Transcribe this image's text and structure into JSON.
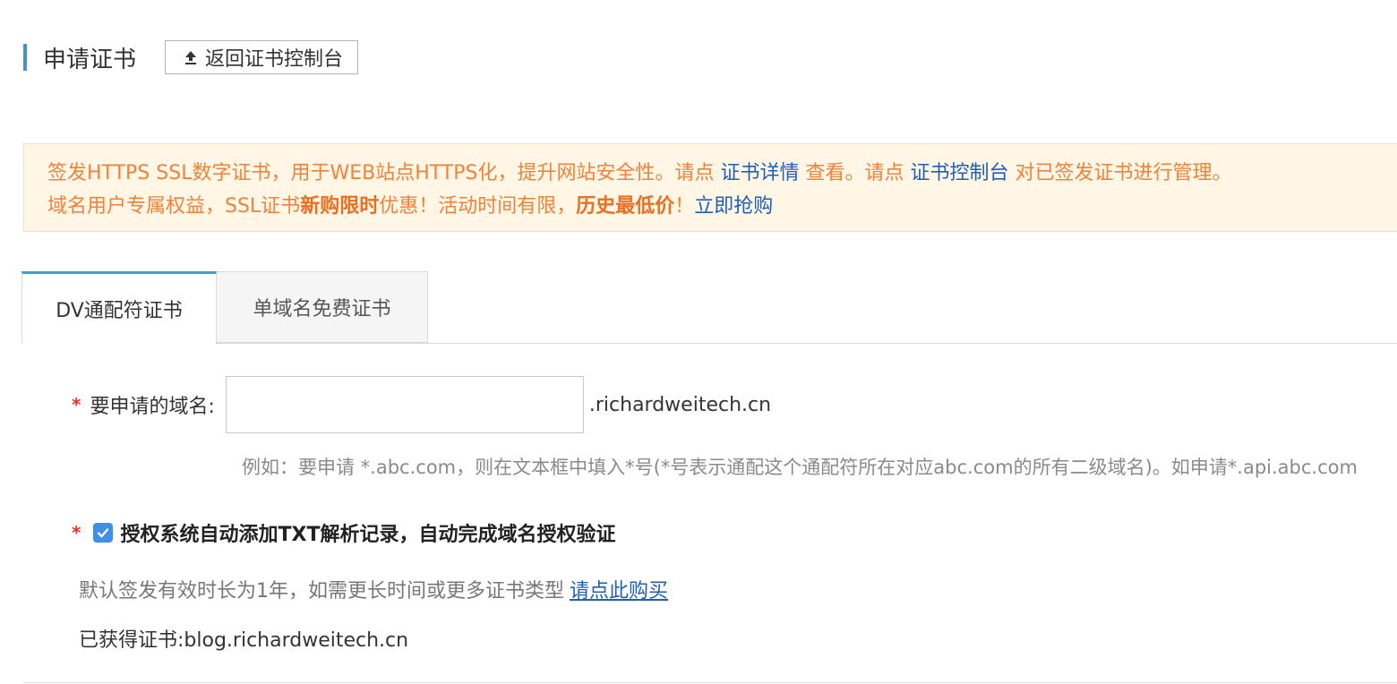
{
  "header": {
    "title": "申请证书",
    "back_button_label": "返回证书控制台",
    "accent_color": "#4a90c8"
  },
  "notice": {
    "line1_prefix": "签发HTTPS SSL数字证书，用于WEB站点HTTPS化，提升网站安全性。请点 ",
    "line1_link1": "证书详情",
    "line1_mid": " 查看。请点 ",
    "line1_link2": "证书控制台",
    "line1_suffix": " 对已签发证书进行管理。",
    "line2_part1": "域名用户专属权益，SSL证书",
    "line2_bold1": "新购限时",
    "line2_part2": "优惠！活动时间有限，",
    "line2_bold2": "历史最低价",
    "line2_part3": "！",
    "line2_link": "立即抢购",
    "text_color": "#f0823a",
    "link_color": "#1f5fb8",
    "background": "#fff6e5"
  },
  "tabs": [
    {
      "label": "DV通配符证书",
      "active": true
    },
    {
      "label": "单域名免费证书",
      "active": false
    }
  ],
  "form": {
    "required_mark": "*",
    "domain_label": "要申请的域名:",
    "domain_value": "",
    "domain_suffix": ".richardweitech.cn",
    "hint": "例如：要申请 *.abc.com，则在文本框中填入*号(*号表示通配这个通配符所在对应abc.com的所有二级域名)。如申请*.api.abc.com",
    "auto_txt_checked": true,
    "auto_txt_label": "授权系统自动添加TXT解析记录，自动完成域名授权验证",
    "default_validity_text": "默认签发有效时长为1年，如需更长时间或更多证书类型",
    "buy_link": "请点此购买",
    "obtained_label": "已获得证书:",
    "obtained_value": "blog.richardweitech.cn"
  }
}
